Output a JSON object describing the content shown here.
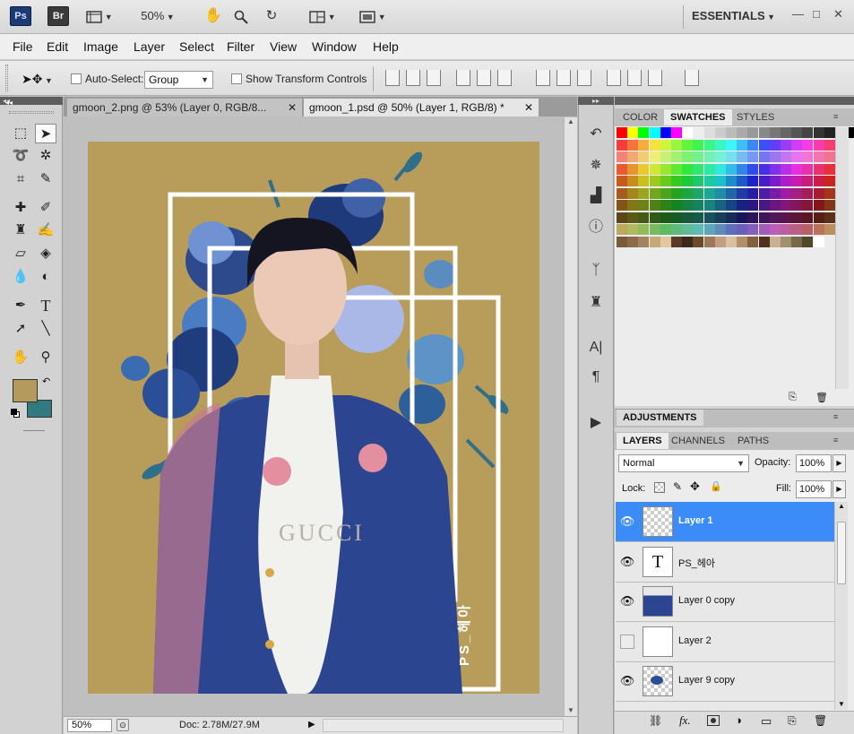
{
  "app": {
    "logo_ps": "Ps",
    "logo_br": "Br",
    "zoom": "50%",
    "workspace": "ESSENTIALS",
    "window_controls": [
      "—",
      "□",
      "✕"
    ]
  },
  "menu": [
    "File",
    "Edit",
    "Image",
    "Layer",
    "Select",
    "Filter",
    "View",
    "Window",
    "Help"
  ],
  "options": {
    "auto_select_label": "Auto-Select:",
    "auto_select_value": "Group",
    "show_transform_label": "Show Transform Controls"
  },
  "tabs": [
    {
      "label": "gmoon_2.png @ 53% (Layer 0, RGB/8...",
      "close": "✕"
    },
    {
      "label": "gmoon_1.psd @ 50% (Layer 1, RGB/8) *",
      "close": "✕"
    }
  ],
  "canvas": {
    "background": "#b89d5a",
    "watermark": "PS_헤아",
    "shirt_text": "GUCCI"
  },
  "status": {
    "zoom": "50%",
    "doc_info": "Doc: 2.78M/27.9M"
  },
  "colors": {
    "foreground": "#b49a5c",
    "background": "#2f7b80"
  },
  "color_panel": {
    "tabs": [
      "COLOR",
      "SWATCHES",
      "STYLES"
    ],
    "selected": "SWATCHES"
  },
  "adjustments": {
    "label": "ADJUSTMENTS"
  },
  "layers_panel": {
    "tabs": [
      "LAYERS",
      "CHANNELS",
      "PATHS"
    ],
    "selected": "LAYERS",
    "blend_mode": "Normal",
    "opacity_label": "Opacity:",
    "opacity_value": "100%",
    "lock_label": "Lock:",
    "fill_label": "Fill:",
    "fill_value": "100%",
    "layers": [
      {
        "name": "Layer 1",
        "visible": true,
        "selected": true,
        "thumb": "transparent"
      },
      {
        "name": "PS_헤아",
        "visible": true,
        "selected": false,
        "thumb": "text"
      },
      {
        "name": "Layer 0 copy",
        "visible": true,
        "selected": false,
        "thumb": "photo"
      },
      {
        "name": "Layer 2",
        "visible": false,
        "selected": false,
        "thumb": "white"
      },
      {
        "name": "Layer 9 copy",
        "visible": true,
        "selected": false,
        "thumb": "flowers"
      }
    ],
    "text_thumb_glyph": "T"
  }
}
